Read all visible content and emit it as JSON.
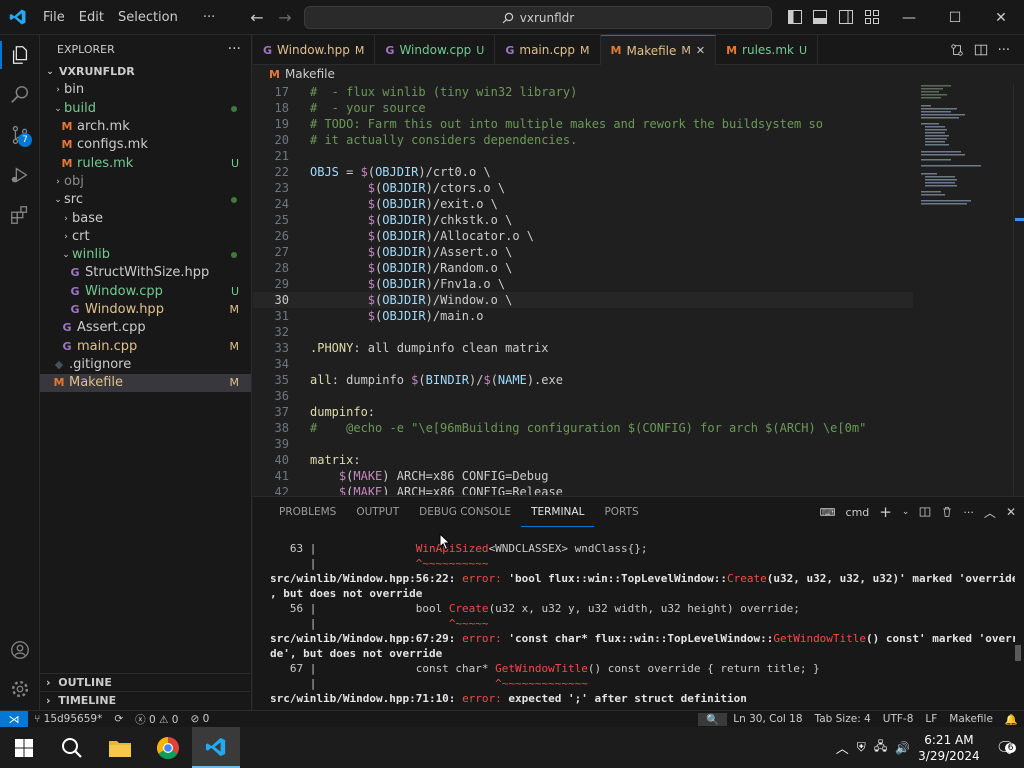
{
  "titlebar": {
    "menus": [
      "File",
      "Edit",
      "Selection"
    ],
    "more": "···",
    "search_text": "vxrunfldr"
  },
  "activitybar": {
    "scm_badge": "7"
  },
  "sidebar": {
    "header": "EXPLORER",
    "root": "VXRUNFLDR",
    "items": [
      {
        "label": "bin",
        "indent": 1,
        "kind": "folder",
        "open": false
      },
      {
        "label": "build",
        "indent": 1,
        "kind": "folder",
        "open": true,
        "color": "#73c991",
        "dot": true
      },
      {
        "label": "arch.mk",
        "indent": 2,
        "kind": "file",
        "color": "#cccccc"
      },
      {
        "label": "configs.mk",
        "indent": 2,
        "kind": "file",
        "color": "#cccccc"
      },
      {
        "label": "rules.mk",
        "indent": 2,
        "kind": "file",
        "color": "#73c991",
        "deco": "U"
      },
      {
        "label": "obj",
        "indent": 1,
        "kind": "folder",
        "open": false,
        "color": "#8c8c8c"
      },
      {
        "label": "src",
        "indent": 1,
        "kind": "folder",
        "open": true,
        "dot": true
      },
      {
        "label": "base",
        "indent": 2,
        "kind": "folder",
        "open": false
      },
      {
        "label": "crt",
        "indent": 2,
        "kind": "folder",
        "open": false
      },
      {
        "label": "winlib",
        "indent": 2,
        "kind": "folder",
        "open": true,
        "color": "#73c991",
        "dot": true
      },
      {
        "label": "StructWithSize.hpp",
        "indent": 3,
        "kind": "cpp",
        "color": "#cccccc"
      },
      {
        "label": "Window.cpp",
        "indent": 3,
        "kind": "cpp",
        "color": "#73c991",
        "deco": "U"
      },
      {
        "label": "Window.hpp",
        "indent": 3,
        "kind": "cpp",
        "color": "#e2c08d",
        "deco": "M"
      },
      {
        "label": "Assert.cpp",
        "indent": 2,
        "kind": "cpp",
        "color": "#cccccc"
      },
      {
        "label": "main.cpp",
        "indent": 2,
        "kind": "cpp",
        "color": "#e2c08d",
        "deco": "M"
      },
      {
        "label": ".gitignore",
        "indent": 1,
        "kind": "git",
        "color": "#cccccc"
      },
      {
        "label": "Makefile",
        "indent": 1,
        "kind": "mk",
        "color": "#e2c08d",
        "deco": "M",
        "selected": true
      }
    ],
    "outline": "OUTLINE",
    "timeline": "TIMELINE"
  },
  "tabs": [
    {
      "label": "Window.hpp",
      "deco": "M",
      "color": "#e2c08d",
      "icon": "C++"
    },
    {
      "label": "Window.cpp",
      "deco": "U",
      "color": "#73c991",
      "icon": "C++"
    },
    {
      "label": "main.cpp",
      "deco": "M",
      "color": "#e2c08d",
      "icon": "C++"
    },
    {
      "label": "Makefile",
      "deco": "M",
      "color": "#e2c08d",
      "icon": "M",
      "active": true
    },
    {
      "label": "rules.mk",
      "deco": "U",
      "color": "#73c991",
      "icon": "M"
    }
  ],
  "breadcrumb": "Makefile",
  "code": [
    {
      "n": 17,
      "t": [
        [
          "cmt",
          "#  - flux winlib (tiny win32 library)"
        ]
      ]
    },
    {
      "n": 18,
      "t": [
        [
          "cmt",
          "#  - your source"
        ]
      ]
    },
    {
      "n": 19,
      "t": [
        [
          "cmt",
          "# TODO: Farm this out into multiple makes and rework the buildsystem so"
        ]
      ]
    },
    {
      "n": 20,
      "t": [
        [
          "cmt",
          "# it actually considers dependencies."
        ]
      ]
    },
    {
      "n": 21,
      "t": []
    },
    {
      "n": 22,
      "t": [
        [
          "var",
          "OBJS"
        ],
        [
          "txt",
          " = "
        ],
        [
          "fn",
          "$"
        ],
        [
          "txt",
          "("
        ],
        [
          "var",
          "OBJDIR"
        ],
        [
          "txt",
          ")/crt0.o \\"
        ]
      ]
    },
    {
      "n": 23,
      "t": [
        [
          "txt",
          "        "
        ],
        [
          "fn",
          "$"
        ],
        [
          "txt",
          "("
        ],
        [
          "var",
          "OBJDIR"
        ],
        [
          "txt",
          ")/ctors.o \\"
        ]
      ]
    },
    {
      "n": 24,
      "t": [
        [
          "txt",
          "        "
        ],
        [
          "fn",
          "$"
        ],
        [
          "txt",
          "("
        ],
        [
          "var",
          "OBJDIR"
        ],
        [
          "txt",
          ")/exit.o \\"
        ]
      ]
    },
    {
      "n": 25,
      "t": [
        [
          "txt",
          "        "
        ],
        [
          "fn",
          "$"
        ],
        [
          "txt",
          "("
        ],
        [
          "var",
          "OBJDIR"
        ],
        [
          "txt",
          ")/chkstk.o \\"
        ]
      ]
    },
    {
      "n": 26,
      "t": [
        [
          "txt",
          "        "
        ],
        [
          "fn",
          "$"
        ],
        [
          "txt",
          "("
        ],
        [
          "var",
          "OBJDIR"
        ],
        [
          "txt",
          ")/Allocator.o \\"
        ]
      ]
    },
    {
      "n": 27,
      "t": [
        [
          "txt",
          "        "
        ],
        [
          "fn",
          "$"
        ],
        [
          "txt",
          "("
        ],
        [
          "var",
          "OBJDIR"
        ],
        [
          "txt",
          ")/Assert.o \\"
        ]
      ]
    },
    {
      "n": 28,
      "t": [
        [
          "txt",
          "        "
        ],
        [
          "fn",
          "$"
        ],
        [
          "txt",
          "("
        ],
        [
          "var",
          "OBJDIR"
        ],
        [
          "txt",
          ")/Random.o \\"
        ]
      ]
    },
    {
      "n": 29,
      "t": [
        [
          "txt",
          "        "
        ],
        [
          "fn",
          "$"
        ],
        [
          "txt",
          "("
        ],
        [
          "var",
          "OBJDIR"
        ],
        [
          "txt",
          ")/Fnv1a.o \\"
        ]
      ]
    },
    {
      "n": 30,
      "t": [
        [
          "txt",
          "        "
        ],
        [
          "fn",
          "$"
        ],
        [
          "txt",
          "("
        ],
        [
          "var",
          "OBJDIR"
        ],
        [
          "txt",
          ")/Window.o \\"
        ]
      ],
      "cur": true
    },
    {
      "n": 31,
      "t": [
        [
          "txt",
          "        "
        ],
        [
          "fn",
          "$"
        ],
        [
          "txt",
          "("
        ],
        [
          "var",
          "OBJDIR"
        ],
        [
          "txt",
          ")/main.o"
        ]
      ]
    },
    {
      "n": 32,
      "t": []
    },
    {
      "n": 33,
      "t": [
        [
          "key",
          ".PHONY"
        ],
        [
          "txt",
          ": all dumpinfo clean matrix"
        ]
      ]
    },
    {
      "n": 34,
      "t": []
    },
    {
      "n": 35,
      "t": [
        [
          "key",
          "all"
        ],
        [
          "txt",
          ": dumpinfo "
        ],
        [
          "fn",
          "$"
        ],
        [
          "txt",
          "("
        ],
        [
          "var",
          "BINDIR"
        ],
        [
          "txt",
          ")/"
        ],
        [
          "fn",
          "$"
        ],
        [
          "txt",
          "("
        ],
        [
          "var",
          "NAME"
        ],
        [
          "txt",
          ").exe"
        ]
      ]
    },
    {
      "n": 36,
      "t": []
    },
    {
      "n": 37,
      "t": [
        [
          "key",
          "dumpinfo"
        ],
        [
          "txt",
          ":"
        ]
      ]
    },
    {
      "n": 38,
      "t": [
        [
          "cmt",
          "#    @echo -e \"\\e[96mBuilding configuration $(CONFIG) for arch $(ARCH) \\e[0m\""
        ]
      ]
    },
    {
      "n": 39,
      "t": []
    },
    {
      "n": 40,
      "t": [
        [
          "key",
          "matrix"
        ],
        [
          "txt",
          ":"
        ]
      ]
    },
    {
      "n": 41,
      "t": [
        [
          "txt",
          "    "
        ],
        [
          "fn",
          "$"
        ],
        [
          "txt",
          "("
        ],
        [
          "fn",
          "MAKE"
        ],
        [
          "txt",
          ") ARCH=x86 CONFIG=Debug"
        ]
      ]
    },
    {
      "n": 42,
      "t": [
        [
          "txt",
          "    "
        ],
        [
          "fn",
          "$"
        ],
        [
          "txt",
          "("
        ],
        [
          "fn",
          "MAKE"
        ],
        [
          "txt",
          ") ARCH=x86 CONFIG=Release"
        ]
      ]
    }
  ],
  "panel": {
    "tabs": [
      "PROBLEMS",
      "OUTPUT",
      "DEBUG CONSOLE",
      "TERMINAL",
      "PORTS"
    ],
    "active_tab": "TERMINAL",
    "shell": "cmd",
    "terminal": [
      [
        [
          "txt",
          "   63 |               "
        ],
        [
          "terr",
          "WinApiSized"
        ],
        [
          "txt",
          "<WNDCLASSEX> wndClass{};"
        ]
      ],
      [
        [
          "txt",
          "      |               "
        ],
        [
          "terr",
          "^~~~~~~~~~~"
        ]
      ],
      [
        [
          "tb",
          "src/winlib/Window.hpp:56:22: "
        ],
        [
          "terr",
          "error: "
        ],
        [
          "tb",
          "'bool flux::win::TopLevelWindow::"
        ],
        [
          "terr",
          "Create"
        ],
        [
          "tb",
          "(u32, u32, u32, u32)' marked 'override'"
        ]
      ],
      [
        [
          "tb",
          ", but does not override"
        ]
      ],
      [
        [
          "txt",
          "   56 |               bool "
        ],
        [
          "terr",
          "Create"
        ],
        [
          "txt",
          "(u32 x, u32 y, u32 width, u32 height) override;"
        ]
      ],
      [
        [
          "txt",
          "      |                    "
        ],
        [
          "terr",
          "^~~~~~"
        ]
      ],
      [
        [
          "tb",
          "src/winlib/Window.hpp:67:29: "
        ],
        [
          "terr",
          "error: "
        ],
        [
          "tb",
          "'const char* flux::win::TopLevelWindow::"
        ],
        [
          "terr",
          "GetWindowTitle"
        ],
        [
          "tb",
          "() const' marked 'overri"
        ]
      ],
      [
        [
          "tb",
          "de', but does not override"
        ]
      ],
      [
        [
          "txt",
          "   67 |               const char* "
        ],
        [
          "terr",
          "GetWindowTitle"
        ],
        [
          "txt",
          "() const override { return title; }"
        ]
      ],
      [
        [
          "txt",
          "      |                           "
        ],
        [
          "terr",
          "^~~~~~~~~~~~~~"
        ]
      ],
      [
        [
          "tb",
          "src/winlib/Window.hpp:71:10: "
        ],
        [
          "terr",
          "error: "
        ],
        [
          "tb",
          "expected ';' after struct definition"
        ]
      ]
    ]
  },
  "statusbar": {
    "branch": "15d95659*",
    "errors": "0",
    "warnings": "0",
    "ports": "0",
    "position": "Ln 30, Col 18",
    "tab_size": "Tab Size: 4",
    "encoding": "UTF-8",
    "eol": "LF",
    "language": "Makefile"
  },
  "taskbar": {
    "time": "6:21 AM",
    "date": "3/29/2024",
    "notif_count": "6"
  },
  "colors": {
    "accent": "#0078d4",
    "modified": "#e2c08d",
    "untracked": "#73c991",
    "error": "#f14c4c"
  }
}
